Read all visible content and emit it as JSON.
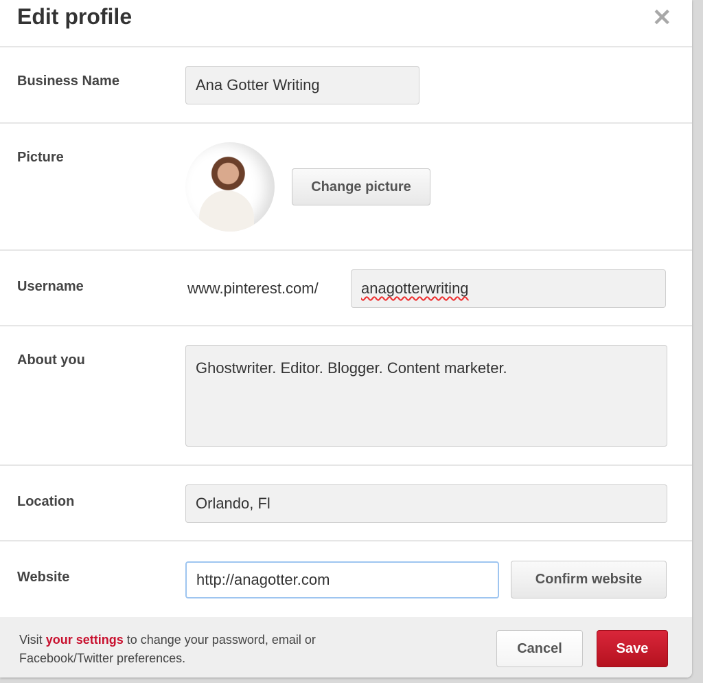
{
  "title": "Edit profile",
  "close_icon": "close-x-icon",
  "business": {
    "label": "Business Name",
    "value": "Ana Gotter Writing"
  },
  "picture": {
    "label": "Picture",
    "button": "Change picture"
  },
  "username": {
    "label": "Username",
    "prefix": "www.pinterest.com/",
    "value": "anagotterwriting"
  },
  "about": {
    "label": "About you",
    "value": "Ghostwriter. Editor. Blogger. Content marketer."
  },
  "location": {
    "label": "Location",
    "value": "Orlando, Fl"
  },
  "website": {
    "label": "Website",
    "value": "http://anagotter.com",
    "button": "Confirm website"
  },
  "footer": {
    "visit": "Visit ",
    "link": "your settings",
    "rest": " to change your password, email or Facebook/Twitter preferences.",
    "cancel": "Cancel",
    "save": "Save"
  },
  "colors": {
    "accent": "#c8102e",
    "focus": "#9ec5f0"
  }
}
